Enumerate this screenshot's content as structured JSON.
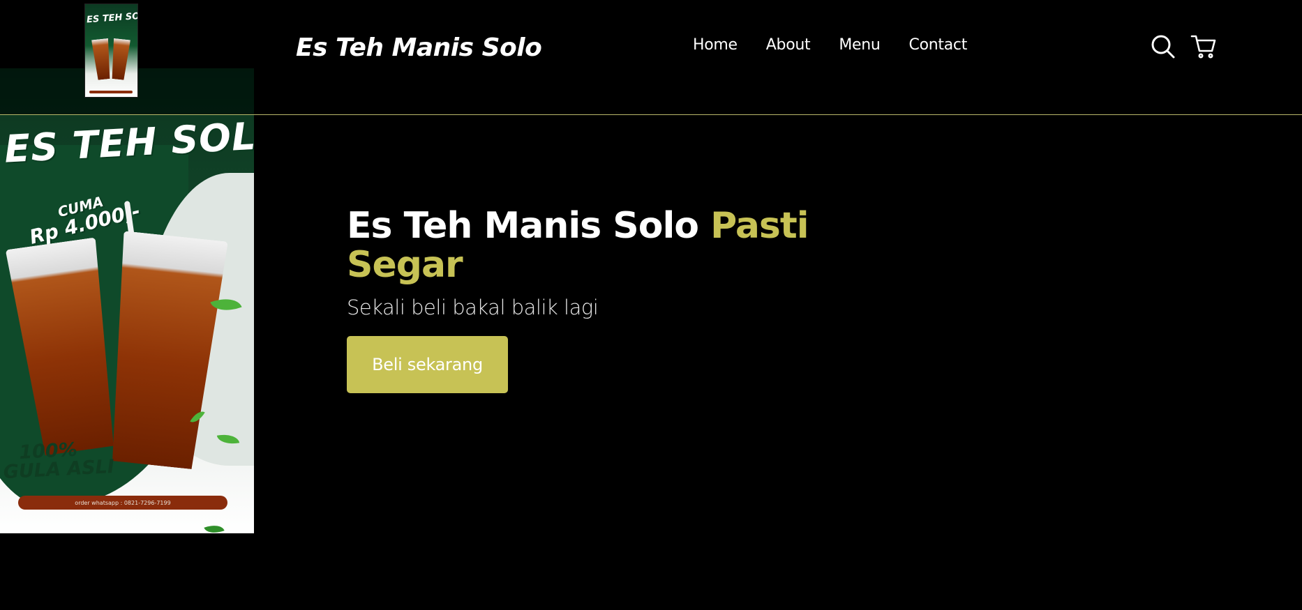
{
  "header": {
    "brand": "Es Teh Manis Solo",
    "nav": [
      "Home",
      "About",
      "Menu",
      "Contact"
    ],
    "icons": [
      "search-icon",
      "cart-icon"
    ]
  },
  "hero": {
    "title_main": "Es Teh Manis Solo",
    "title_accent": "Pasti Segar",
    "subtitle": "Sekali beli bakal balik lagi",
    "cta": "Beli sekarang"
  },
  "poster": {
    "title": "ES TEH SOLO",
    "price_prefix": "CUMA",
    "price": "Rp 4.000,-",
    "claim_line1": "100%",
    "claim_line2": "GULA ASLI",
    "order": "order whatsapp : 0821-7296-7199"
  },
  "logo_thumb": {
    "title": "ES TEH SOLO"
  },
  "colors": {
    "background": "#000000",
    "accent": "#c7c255",
    "text": "#ffffff",
    "divider": "#b9b86a"
  }
}
